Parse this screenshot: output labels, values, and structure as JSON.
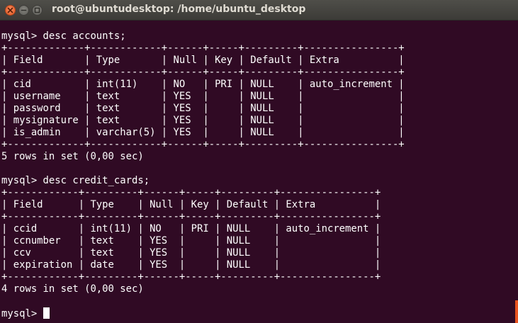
{
  "window": {
    "title": "root@ubuntudesktop: /home/ubuntu_desktop",
    "controls": {
      "close_icon": "close-icon",
      "minimize_icon": "minimize-icon",
      "maximize_icon": "maximize-icon"
    }
  },
  "terminal": {
    "colors": {
      "background": "#300a24",
      "foreground": "#ffffff",
      "scroll_thumb": "#e95420"
    },
    "lines": [
      "mysql> desc accounts;",
      "+-------------+------------+------+-----+---------+----------------+",
      "| Field       | Type       | Null | Key | Default | Extra          |",
      "+-------------+------------+------+-----+---------+----------------+",
      "| cid         | int(11)    | NO   | PRI | NULL    | auto_increment |",
      "| username    | text       | YES  |     | NULL    |                |",
      "| password    | text       | YES  |     | NULL    |                |",
      "| mysignature | text       | YES  |     | NULL    |                |",
      "| is_admin    | varchar(5) | YES  |     | NULL    |                |",
      "+-------------+------------+------+-----+---------+----------------+",
      "5 rows in set (0,00 sec)",
      "",
      "mysql> desc credit_cards;",
      "+------------+---------+------+-----+---------+----------------+",
      "| Field      | Type    | Null | Key | Default | Extra          |",
      "+------------+---------+------+-----+---------+----------------+",
      "| ccid       | int(11) | NO   | PRI | NULL    | auto_increment |",
      "| ccnumber   | text    | YES  |     | NULL    |                |",
      "| ccv        | text    | YES  |     | NULL    |                |",
      "| expiration | date    | YES  |     | NULL    |                |",
      "+------------+---------+------+-----+---------+----------------+",
      "4 rows in set (0,00 sec)",
      ""
    ],
    "prompt": "mysql> "
  }
}
